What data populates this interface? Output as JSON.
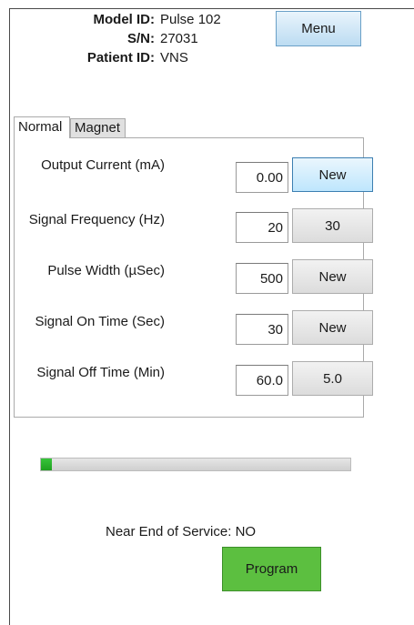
{
  "header": {
    "model_id_label": "Model ID:",
    "model_id_value": "Pulse 102",
    "serial_label": "S/N:",
    "serial_value": "27031",
    "patient_id_label": "Patient ID:",
    "patient_id_value": "VNS"
  },
  "menu_button_label": "Menu",
  "tabs": [
    {
      "label": "Normal",
      "selected": true
    },
    {
      "label": "Magnet",
      "selected": false
    }
  ],
  "parameters": [
    {
      "label": "Output Current (mA)",
      "value": "0.00",
      "button": "New"
    },
    {
      "label": "Signal Frequency (Hz)",
      "value": "20",
      "button": "30"
    },
    {
      "label": "Pulse Width (µSec)",
      "value": "500",
      "button": "New"
    },
    {
      "label": "Signal On Time (Sec)",
      "value": "30",
      "button": "New"
    },
    {
      "label": "Signal Off Time (Min)",
      "value": "60.0",
      "button": "5.0"
    }
  ],
  "progress": {
    "fraction": 0.035,
    "color": "#2db52f"
  },
  "status_text": "Near End of Service: NO",
  "program_button_label": "Program",
  "colors": {
    "program_button": "#5cbf40",
    "active_button": "#bee6fd"
  }
}
